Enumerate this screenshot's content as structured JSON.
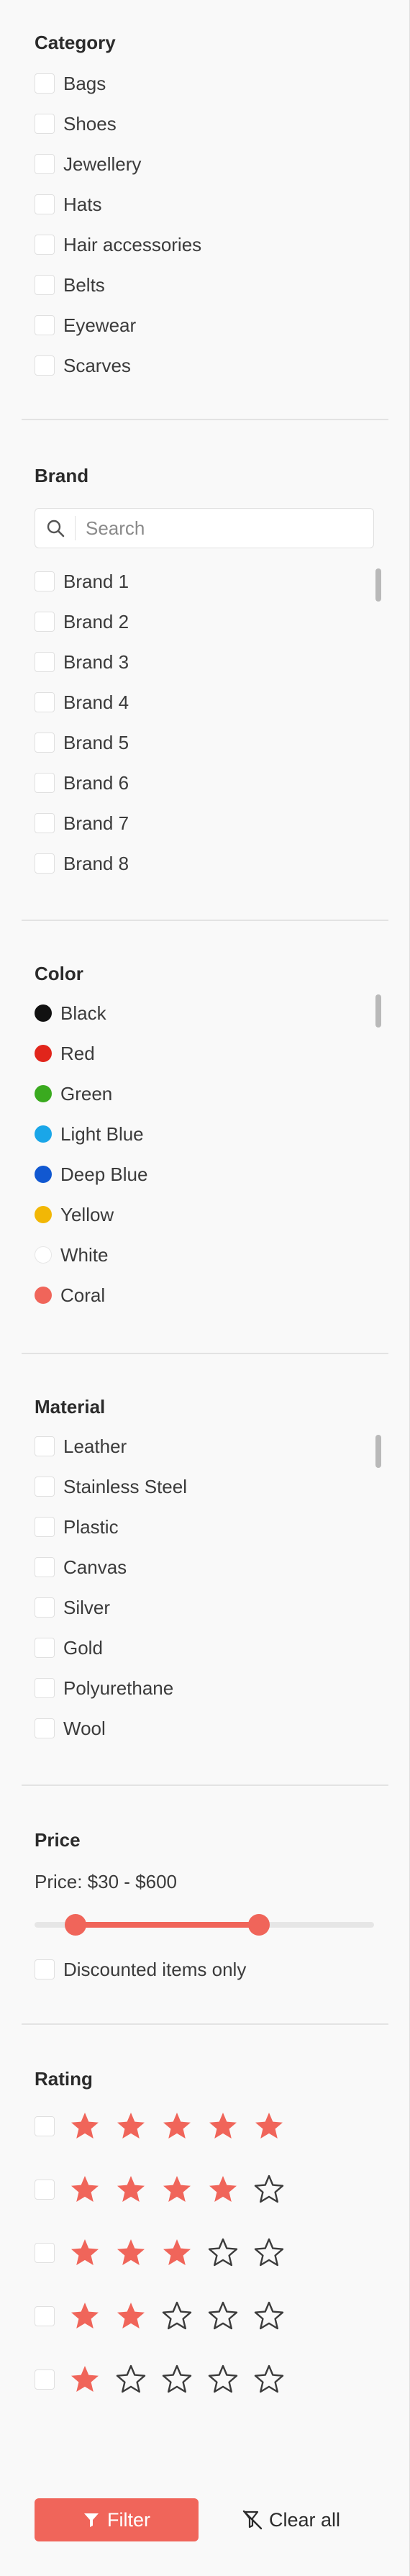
{
  "category": {
    "title": "Category",
    "items": [
      "Bags",
      "Shoes",
      "Jewellery",
      "Hats",
      "Hair accessories",
      "Belts",
      "Eyewear",
      "Scarves"
    ]
  },
  "brand": {
    "title": "Brand",
    "search_placeholder": "Search",
    "items": [
      "Brand 1",
      "Brand 2",
      "Brand 3",
      "Brand 4",
      "Brand 5",
      "Brand 6",
      "Brand 7",
      "Brand 8"
    ]
  },
  "color": {
    "title": "Color",
    "items": [
      {
        "label": "Black",
        "hex": "#111111"
      },
      {
        "label": "Red",
        "hex": "#e1251b"
      },
      {
        "label": "Green",
        "hex": "#3aaa1f"
      },
      {
        "label": "Light Blue",
        "hex": "#1aa6e8"
      },
      {
        "label": "Deep Blue",
        "hex": "#1158d1"
      },
      {
        "label": "Yellow",
        "hex": "#f2b705"
      },
      {
        "label": "White",
        "hex": "#ffffff"
      },
      {
        "label": "Coral",
        "hex": "#f0655a"
      }
    ]
  },
  "material": {
    "title": "Material",
    "items": [
      "Leather",
      "Stainless Steel",
      "Plastic",
      "Canvas",
      "Silver",
      "Gold",
      "Polyurethane",
      "Wool"
    ]
  },
  "price": {
    "title": "Price",
    "range_text": "Price: $30 - $600",
    "slider_low_fraction": 0.12,
    "slider_high_fraction": 0.66,
    "discount_label": "Discounted items only"
  },
  "rating": {
    "title": "Rating",
    "rows": [
      5,
      4,
      3,
      2,
      1
    ],
    "max": 5
  },
  "actions": {
    "filter_label": "Filter",
    "clear_label": "Clear all"
  },
  "colors": {
    "accent": "#f0655a"
  },
  "icons": {
    "search": "search-icon",
    "filter": "filter-icon",
    "clear": "clear-filter-icon",
    "star": "star-icon"
  }
}
